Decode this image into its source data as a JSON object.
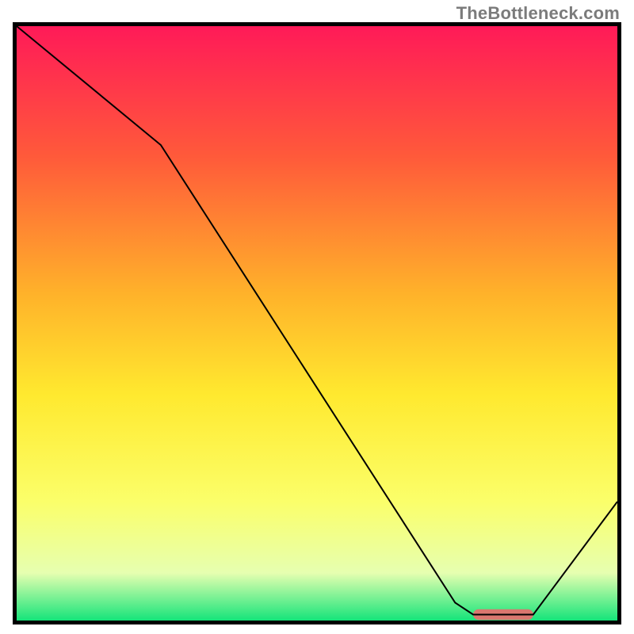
{
  "watermark": "TheBottleneck.com",
  "chart_data": {
    "type": "line",
    "title": "",
    "xlabel": "",
    "ylabel": "",
    "xlim": [
      0,
      100
    ],
    "ylim": [
      0,
      100
    ],
    "grid": false,
    "legend": false,
    "background_gradient_stops": [
      {
        "pct": 0,
        "color": "#ff1a58"
      },
      {
        "pct": 22,
        "color": "#ff5a3a"
      },
      {
        "pct": 45,
        "color": "#ffb22a"
      },
      {
        "pct": 62,
        "color": "#ffe92f"
      },
      {
        "pct": 80,
        "color": "#fbff6a"
      },
      {
        "pct": 92,
        "color": "#e6ffb0"
      },
      {
        "pct": 100,
        "color": "#15e47a"
      }
    ],
    "curve": {
      "name": "bottleneck-curve",
      "color": "#000000",
      "width": 2,
      "points": [
        {
          "x": 0,
          "y": 100
        },
        {
          "x": 24,
          "y": 80
        },
        {
          "x": 73,
          "y": 3
        },
        {
          "x": 76,
          "y": 1
        },
        {
          "x": 86,
          "y": 1
        },
        {
          "x": 100,
          "y": 20
        }
      ]
    },
    "marker": {
      "name": "optimal-range",
      "color": "#d9776f",
      "x_start": 76,
      "x_end": 86,
      "y": 1,
      "thickness_pct": 1.8
    }
  }
}
